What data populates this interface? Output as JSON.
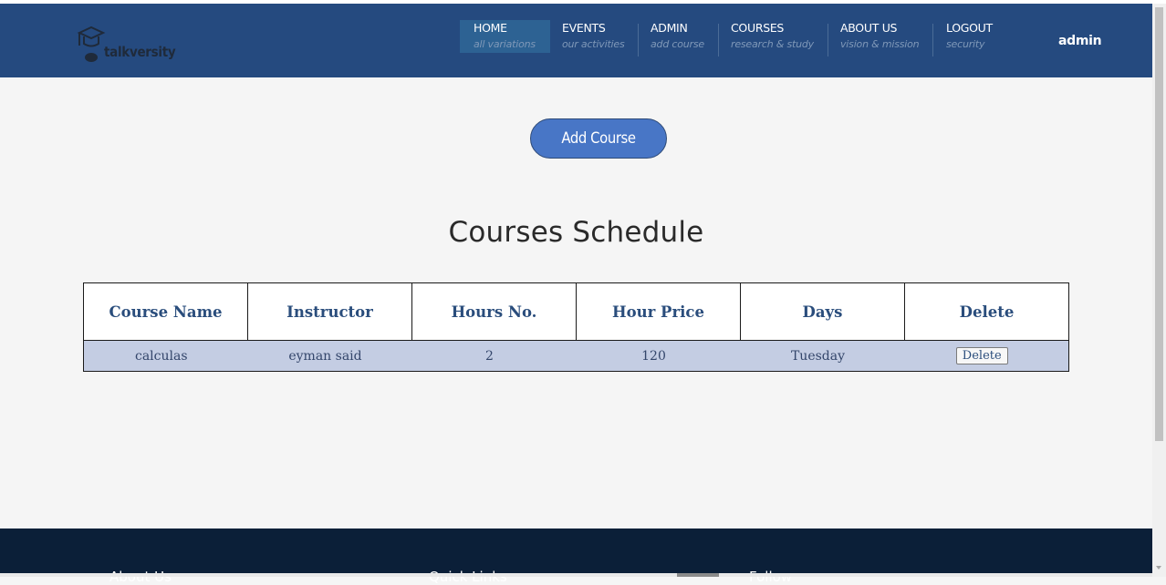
{
  "brand": {
    "logo_text": "talkversity"
  },
  "nav": {
    "items": [
      {
        "label": "HOME",
        "sub": "all variations"
      },
      {
        "label": "EVENTS",
        "sub": "our activities"
      },
      {
        "label": "ADMIN",
        "sub": "add course"
      },
      {
        "label": "COURSES",
        "sub": "research & study"
      },
      {
        "label": "ABOUT US",
        "sub": "vision & mission"
      },
      {
        "label": "LOGOUT",
        "sub": "security"
      }
    ],
    "active_index": 0
  },
  "user": {
    "name": "admin"
  },
  "main": {
    "add_button_label": "Add Course",
    "title": "Courses Schedule",
    "table": {
      "headers": [
        "Course Name",
        "Instructor",
        "Hours No.",
        "Hour Price",
        "Days",
        "Delete"
      ],
      "rows": [
        {
          "course_name": "calculas",
          "instructor": "eyman said",
          "hours_no": "2",
          "hour_price": "120",
          "days": "Tuesday",
          "delete_label": "Delete"
        }
      ]
    }
  },
  "footer": {
    "headings": [
      "About Us",
      "Quick Links",
      "Follow"
    ]
  },
  "colors": {
    "header_bg": "#254a7f",
    "active_nav_bg": "#2d6293",
    "accent_button": "#4876c6",
    "table_row_bg": "#c4cde3",
    "footer_bg": "#0b1f38"
  }
}
